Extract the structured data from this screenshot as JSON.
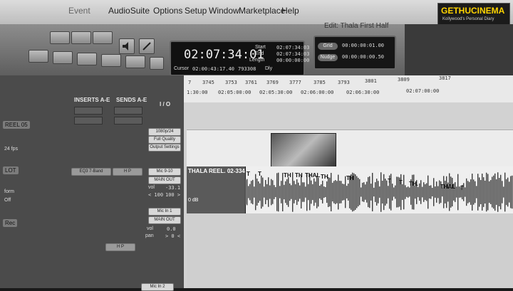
{
  "menubar": {
    "items": [
      "Event",
      "AudioSuite",
      "Options",
      "Setup",
      "Window",
      "Marketplace",
      "Help"
    ]
  },
  "edit_window": {
    "title": "Edit: Thala First Half"
  },
  "counter": {
    "main_time": "02:07:34:01",
    "start_label": "Start",
    "start_value": "02:07:34:03",
    "end_label": "End",
    "end_value": "02:07:34:03",
    "length_label": "Length",
    "length_value": "00:00:00:00",
    "cursor_label": "Cursor",
    "cursor_value": "02:00:43:17.40",
    "samples": "793308",
    "dly_label": "Dly"
  },
  "grid_nudge": {
    "grid_label": "Grid",
    "grid_value": "00:00:00:01.00",
    "nudge_label": "Nudge",
    "nudge_value": "00:00:00:00.50"
  },
  "ruler": {
    "bars": [
      "7",
      "3745",
      "3753",
      "3761",
      "3769",
      "3777",
      "3785",
      "3793",
      "3801",
      "3809",
      "3817"
    ],
    "timecodes": [
      "1:30:00",
      "02:05:00:00",
      "02:05:30:00",
      "02:06:00:00",
      "02:06:30:00",
      "02:07:00:00"
    ]
  },
  "mixer": {
    "inserts_header": "INSERTS A-E",
    "sends_header": "SENDS A-E",
    "io_header": "I / O",
    "track_labels": [
      "REEL 05",
      "LOT",
      "Rec"
    ],
    "side_labels": [
      "24 fps",
      "form",
      "Off"
    ],
    "eq_plugin": "EQ3 7-Band",
    "hp_button": "H P",
    "hp_button_2": "H P",
    "video_io": {
      "format": "1080p/24",
      "quality": "Full Quality",
      "settings": "Output Settings"
    },
    "ch1": {
      "input": "Mic 9-10",
      "output": "MAIN OUT",
      "vol_label": "vol",
      "vol_value": "-33.1",
      "pan_left": "< 100",
      "pan_right": "100 >"
    },
    "ch2": {
      "input": "Mic In 1",
      "output": "MAIN OUT",
      "vol_label": "vol",
      "vol_value": "0.0",
      "pan_label": "pan",
      "pan_value": "> 0 <"
    },
    "ch3": {
      "input": "Mic In 2"
    }
  },
  "tracks": {
    "audio_clip_name": "THALA REEL. 02-334",
    "gain": "0 dB",
    "clip_labels": [
      "T",
      "T",
      "TH",
      "TH",
      "THAL",
      "TH",
      "TH",
      "T",
      "T",
      "TH.",
      "THAL",
      "T"
    ]
  },
  "logo": {
    "name": "GETHUCINEMA",
    "tagline": "Kollywood's Personal Diary"
  },
  "colors": {
    "accent": "#ff5a4e",
    "waveform": "#4a4a4a",
    "timeline": "#d2d2d2"
  }
}
